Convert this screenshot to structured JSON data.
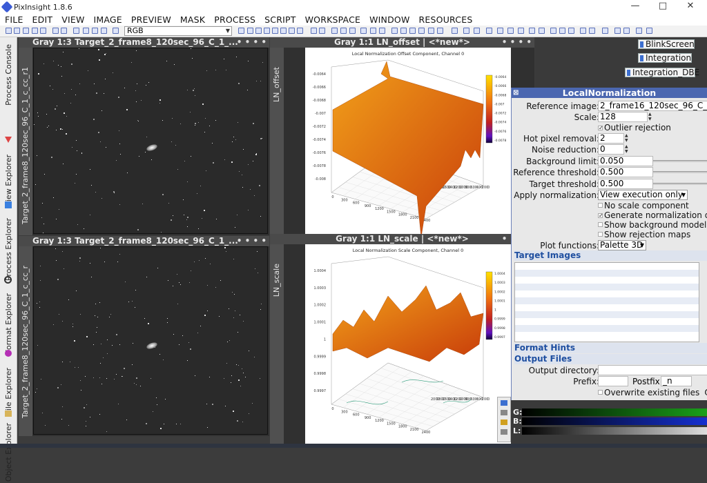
{
  "app": {
    "title": "PixInsight 1.8.6",
    "win_min": "—",
    "win_max": "□",
    "win_close": "✕"
  },
  "menu": [
    "FILE",
    "EDIT",
    "VIEW",
    "IMAGE",
    "PREVIEW",
    "MASK",
    "PROCESS",
    "SCRIPT",
    "WORKSPACE",
    "WINDOW",
    "RESOURCES"
  ],
  "toolbar": {
    "mode_select": "RGB"
  },
  "left_tabs": [
    {
      "label": "Process Console",
      "icon": "console-icon"
    },
    {
      "label": "View Explorer",
      "icon": "view-explorer-icon"
    },
    {
      "label": "Process Explorer",
      "icon": "gear-icon"
    },
    {
      "label": "Format Explorer",
      "icon": "format-icon"
    },
    {
      "label": "File Explorer",
      "icon": "folder-icon"
    },
    {
      "label": "Object Explorer",
      "icon": "object-icon"
    }
  ],
  "windows": {
    "img1": {
      "title": "Gray 1:3 Target_2_frame8_120sec_96_C_1_...",
      "side": "Target_2_frame8_120sec_96_C_1_c_cc_r1",
      "menu": "• • • •"
    },
    "img2": {
      "title": "Gray 1:3 Target_2_frame8_120sec_96_C_1_...",
      "side": "Target_2_frame8_120sec_96_C_1_c_cc_r",
      "menu": "• • • •"
    },
    "plot1": {
      "title": "Gray 1:1 LN_offset | <*new*>",
      "side": "LN_offset",
      "menu": "• • • •"
    },
    "plot2": {
      "title": "Gray 1:1 LN_scale | <*new*>",
      "side": "LN_scale",
      "menu": "• • • •"
    }
  },
  "plots": {
    "offset": {
      "title": "Local Normalization Offset Component, Channel 0",
      "z_ticks": [
        "-0.0064",
        "-0.0066",
        "-0.0068",
        "-0.007",
        "-0.0072",
        "-0.0074",
        "-0.0076",
        "-0.0078",
        "-0.008"
      ],
      "colorbar_ticks": [
        "-0.0064",
        "-0.0066",
        "-0.0068",
        "-0.007",
        "-0.0072",
        "-0.0074",
        "-0.0076",
        "-0.0078"
      ],
      "x_ticks": [
        "0",
        "300",
        "600",
        "900",
        "1200",
        "1500",
        "1800",
        "2100",
        "2400"
      ],
      "y_ticks": [
        "0",
        "200",
        "400",
        "600",
        "800",
        "1000",
        "1200",
        "1400",
        "1600",
        "1800",
        "2000"
      ]
    },
    "scale": {
      "title": "Local Normalization Scale Component, Channel 0",
      "z_ticks": [
        "1.0004",
        "1.0003",
        "1.0002",
        "1.0001",
        "1",
        "0.9999",
        "0.9998",
        "0.9997"
      ],
      "colorbar_ticks": [
        "1.0004",
        "1.0003",
        "1.0002",
        "1.0001",
        "1",
        "0.9999",
        "0.9998",
        "0.9997"
      ],
      "x_ticks": [
        "0",
        "300",
        "600",
        "900",
        "1200",
        "1500",
        "1800",
        "2100",
        "2400"
      ],
      "y_ticks": [
        "0",
        "200",
        "400",
        "600",
        "800",
        "1000",
        "1200",
        "1400",
        "1600",
        "1800",
        "2000"
      ]
    }
  },
  "process_icons": [
    "BlinkScreen",
    "Integration",
    "Integration_DBE"
  ],
  "ln": {
    "title": "LocalNormalization",
    "reference_image_label": "Reference image:",
    "reference_image": "2_frame16_120sec_96_C_c_",
    "scale_label": "Scale:",
    "scale": "128",
    "outlier_rejection": "Outlier rejection",
    "hot_pixel_label": "Hot pixel removal:",
    "hot_pixel": "2",
    "noise_label": "Noise reduction:",
    "noise": "0",
    "bg_limit_label": "Background limit:",
    "bg_limit": "0.050",
    "ref_thr_label": "Reference threshold:",
    "ref_thr": "0.500",
    "tgt_thr_label": "Target threshold:",
    "tgt_thr": "0.500",
    "apply_label": "Apply normalization:",
    "apply": "View execution only",
    "no_scale": "No scale component",
    "gen_data": "Generate normalization dat",
    "show_bg": "Show background models",
    "show_rej": "Show rejection maps",
    "plot_label": "Plot functions:",
    "plot": "Palette 3D",
    "target_images": "Target Images",
    "format_hints": "Format Hints",
    "output_files": "Output Files",
    "out_dir_label": "Output directory:",
    "prefix_label": "Prefix:",
    "postfix_label": "Postfix:",
    "postfix": "_n",
    "overwrite": "Overwrite existing files",
    "overwrite_tail": "On"
  },
  "histogram": {
    "g": "G:",
    "b": "B:",
    "l": "L:"
  },
  "colors": {
    "panel_head": "#4b67b0",
    "section": "#1f4fa0",
    "surface_hi": "#f2a11a",
    "surface_lo": "#c83c0a"
  }
}
